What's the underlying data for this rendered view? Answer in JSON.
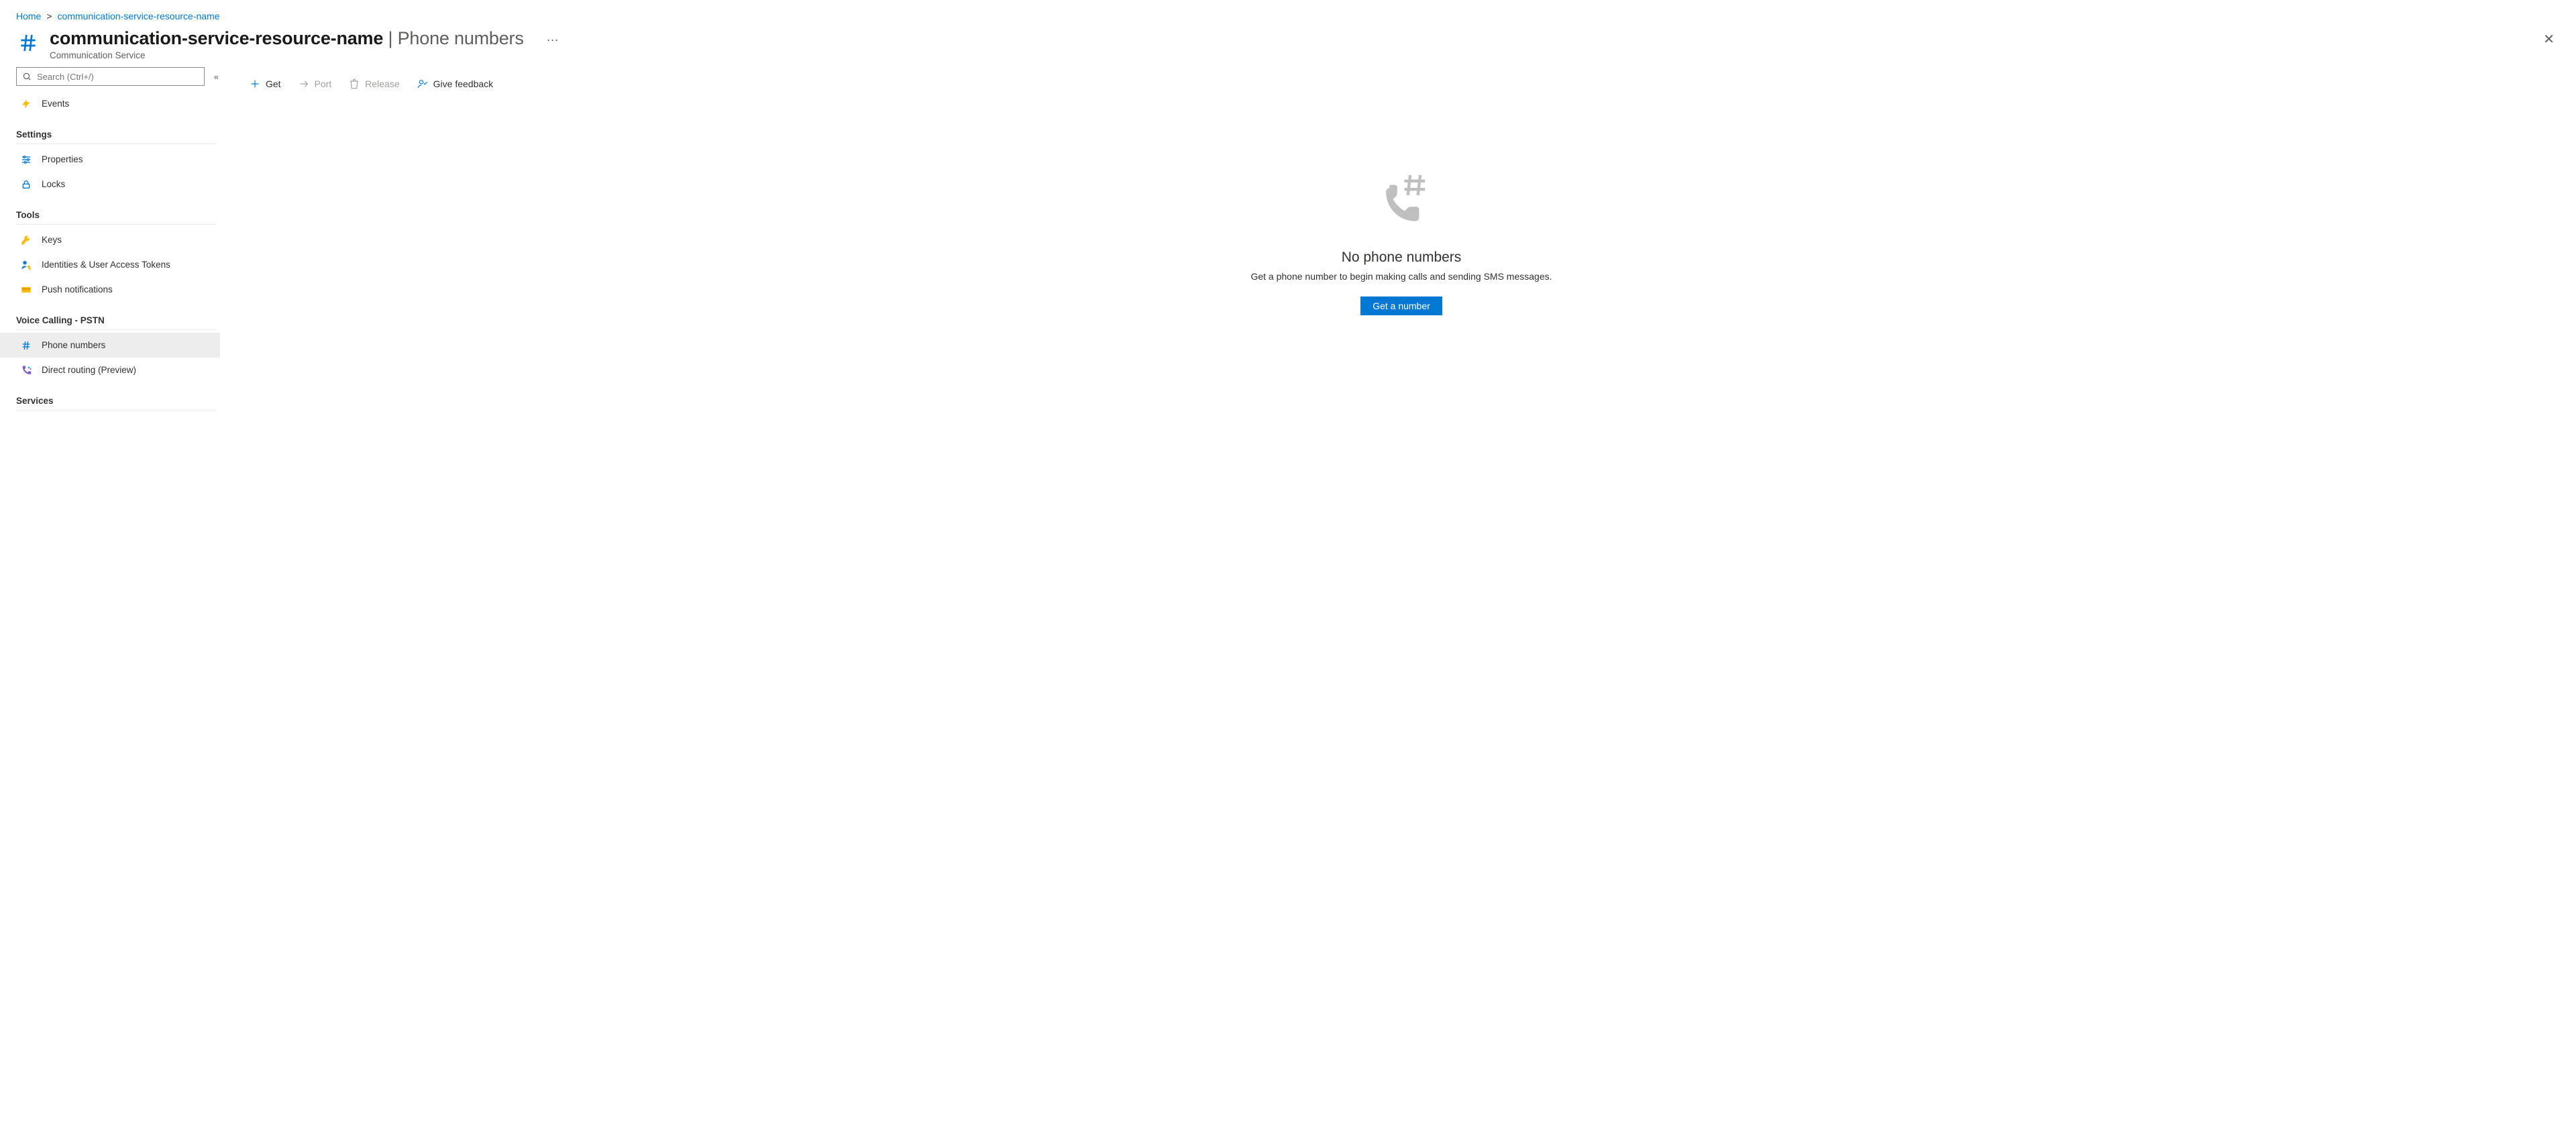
{
  "breadcrumb": {
    "home": "Home",
    "resource": "communication-service-resource-name"
  },
  "header": {
    "resource_name": "communication-service-resource-name",
    "section": "Phone numbers",
    "subtitle": "Communication Service"
  },
  "sidebar": {
    "search_placeholder": "Search (Ctrl+/)",
    "events": "Events",
    "group_settings": "Settings",
    "properties": "Properties",
    "locks": "Locks",
    "group_tools": "Tools",
    "keys": "Keys",
    "identities": "Identities & User Access Tokens",
    "push": "Push notifications",
    "group_voice": "Voice Calling - PSTN",
    "phone_numbers": "Phone numbers",
    "direct_routing": "Direct routing (Preview)",
    "group_services": "Services"
  },
  "toolbar": {
    "get": "Get",
    "port": "Port",
    "release": "Release",
    "feedback": "Give feedback"
  },
  "empty": {
    "title": "No phone numbers",
    "desc": "Get a phone number to begin making calls and sending SMS messages.",
    "cta": "Get a number"
  }
}
